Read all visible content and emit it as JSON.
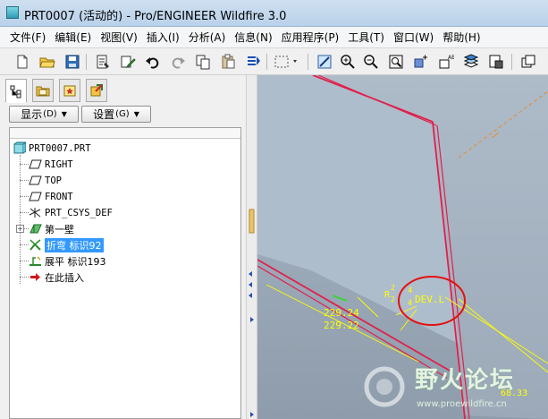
{
  "window": {
    "title": "PRT0007 (活动的) - Pro/ENGINEER Wildfire 3.0"
  },
  "menu": [
    "文件(F)",
    "编辑(E)",
    "视图(V)",
    "插入(I)",
    "分析(A)",
    "信息(N)",
    "应用程序(P)",
    "工具(T)",
    "窗口(W)",
    "帮助(H)"
  ],
  "navigator": {
    "show_label": "显示",
    "show_hotkey": "(D)",
    "settings_label": "设置",
    "settings_hotkey": "(G)"
  },
  "tree": {
    "root": "PRT0007.PRT",
    "items": [
      "RIGHT",
      "TOP",
      "FRONT",
      "PRT_CSYS_DEF",
      "第一壁",
      "折弯 标识92",
      "展平 标识193",
      "在此插入"
    ]
  },
  "viewport": {
    "dim1": "229.24",
    "dim2": "229.22",
    "radius_label": "R",
    "radius_num_top": "2",
    "radius_num_bottom": "2",
    "dev_num_top": "4",
    "dev_num_bottom": "4",
    "dev_label": "DEV.L",
    "corner_dim": "68.33"
  },
  "watermark": {
    "text": "野火论坛",
    "url": "www.proewildfire.cn"
  },
  "colors": {
    "model_edge": "#e0204a",
    "dimension": "#ffff00",
    "highlight_circle": "#e41010",
    "selection": "#3399ff"
  }
}
